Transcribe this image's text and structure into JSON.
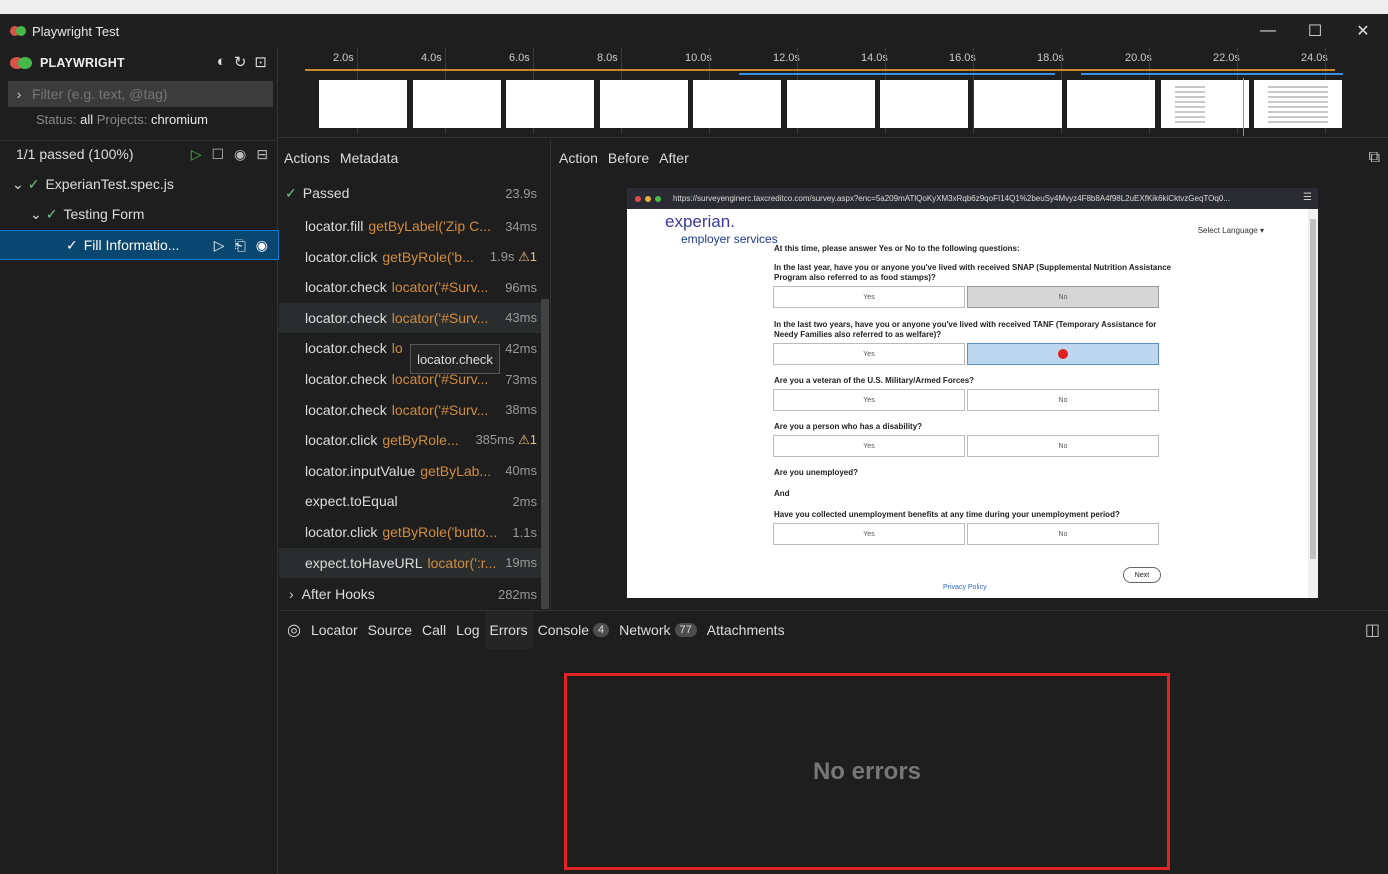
{
  "window": {
    "title": "Playwright Test",
    "minimize": "—",
    "maximize": "☐",
    "close": "✕"
  },
  "sidebar": {
    "brand": "PLAYWRIGHT",
    "filter_placeholder": "Filter (e.g. text, @tag)",
    "status_label": "Status:",
    "status_value": "all",
    "projects_label": "Projects:",
    "projects_value": "chromium",
    "pass_summary": "1/1 passed (100%)",
    "tree": [
      {
        "label": "ExperianTest.spec.js"
      },
      {
        "label": "Testing Form"
      },
      {
        "label": "Fill Informatio..."
      }
    ]
  },
  "timeline": {
    "ticks": [
      "2.0s",
      "4.0s",
      "6.0s",
      "8.0s",
      "10.0s",
      "12.0s",
      "14.0s",
      "16.0s",
      "18.0s",
      "20.0s",
      "22.0s",
      "24.0s"
    ]
  },
  "actions_panel": {
    "tabs": [
      "Actions",
      "Metadata"
    ],
    "passed_label": "Passed",
    "passed_duration": "23.9s",
    "rows": [
      {
        "name": "locator.fill",
        "locator": "getByLabel('Zip C...",
        "duration": "34ms",
        "warn": ""
      },
      {
        "name": "locator.click",
        "locator": "getByRole('b...",
        "duration": "1.9s",
        "warn": "⚠1"
      },
      {
        "name": "locator.check",
        "locator": "locator('#Surv...",
        "duration": "96ms",
        "warn": ""
      },
      {
        "name": "locator.check",
        "locator": "locator('#Surv...",
        "duration": "43ms",
        "warn": ""
      },
      {
        "name": "locator.check",
        "locator": "lo",
        "duration": "42ms",
        "warn": ""
      },
      {
        "name": "locator.check",
        "locator": "locator('#Surv...",
        "duration": "73ms",
        "warn": ""
      },
      {
        "name": "locator.check",
        "locator": "locator('#Surv...",
        "duration": "38ms",
        "warn": ""
      },
      {
        "name": "locator.click",
        "locator": "getByRole...",
        "duration": "385ms",
        "warn": "⚠1"
      },
      {
        "name": "locator.inputValue",
        "locator": "getByLab...",
        "duration": "40ms",
        "warn": ""
      },
      {
        "name": "expect.toEqual",
        "locator": "",
        "duration": "2ms",
        "warn": ""
      },
      {
        "name": "locator.click",
        "locator": "getByRole('butto...",
        "duration": "1.1s",
        "warn": ""
      },
      {
        "name": "expect.toHaveURL",
        "locator": "locator(':r...",
        "duration": "19ms",
        "warn": ""
      }
    ],
    "after_hooks_label": "After Hooks",
    "after_hooks_duration": "282ms",
    "tooltip": "locator.check"
  },
  "snapshot": {
    "tabs": [
      "Action",
      "Before",
      "After"
    ],
    "url": "https://surveyenginerc.taxcreditco.com/survey.aspx?enc=5a209mATlQoKyXM3xRqb6z9qoFI14Q1%2beuSy4Mvyz4F8b8A4f98L2uEXfKik6kiCktvzGeqTOq0...",
    "logo": "experian.",
    "logo_sub": "employer services",
    "language": "Select Language ▾",
    "intro": "At this time, please answer Yes or No to the following questions:",
    "q1": "In the last year, have you or anyone you've lived with received SNAP (Supplemental Nutrition Assistance Program also referred to as food stamps)?",
    "q2": "In the last two years, have you or anyone you've lived with received TANF (Temporary Assistance for Needy Families also referred to as welfare)?",
    "q3": "Are you a veteran of the U.S. Military/Armed Forces?",
    "q4": "Are you a person who has a disability?",
    "q5": "Are you unemployed?",
    "and": "And",
    "q6": "Have you collected unemployment benefits at any time during your unemployment period?",
    "yes": "Yes",
    "no": "No",
    "next": "Next",
    "privacy": "Privacy Policy"
  },
  "bottom_panel": {
    "tabs": {
      "locator": "Locator",
      "source": "Source",
      "call": "Call",
      "log": "Log",
      "errors": "Errors",
      "console": "Console",
      "console_count": "4",
      "network": "Network",
      "network_count": "77",
      "attachments": "Attachments"
    },
    "message": "No errors"
  }
}
